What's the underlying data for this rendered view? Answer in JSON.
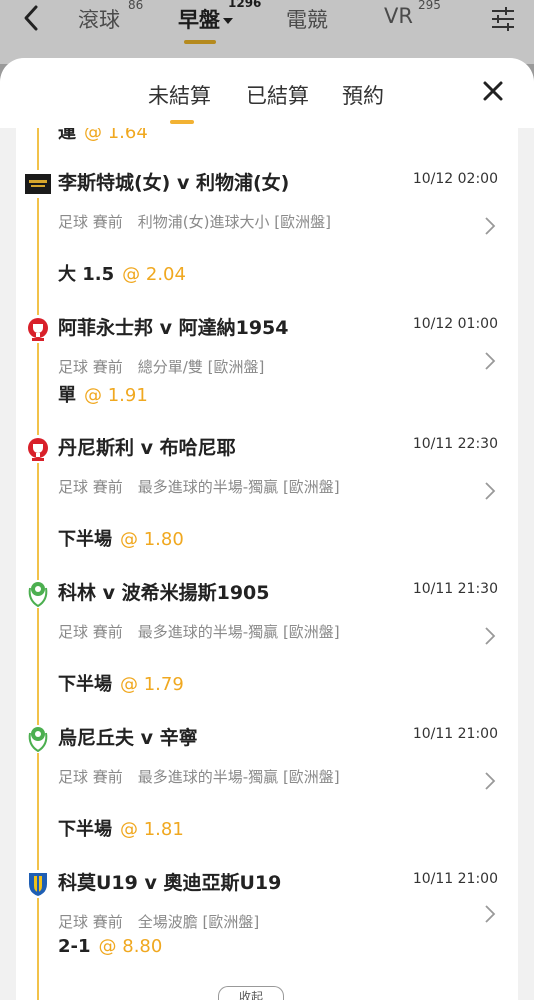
{
  "top_nav": {
    "tabs": [
      {
        "label": "滾球",
        "count": "86"
      },
      {
        "label": "早盤",
        "count": "1296"
      },
      {
        "label": "電競",
        "count": ""
      },
      {
        "label": "VR",
        "count": "295"
      }
    ],
    "active_tab": "早盤"
  },
  "sheet": {
    "tabs": [
      "未結算",
      "已結算",
      "預約"
    ],
    "active_tab": "未結算"
  },
  "partial_row": {
    "pick": "運",
    "odds": "@ 1.64"
  },
  "bets": [
    {
      "logo": "league-badge-dark",
      "teams": "李斯特城(女) v 利物浦(女)",
      "time": "10/12 02:00",
      "desc": "足球 賽前　利物浦(女)進球大小 [歐洲盤]",
      "pick": "大 1.5",
      "odds": "@ 2.04"
    },
    {
      "logo": "cup-trophy-red",
      "teams": "阿菲永士邦 v 阿達納1954",
      "time": "10/12 01:00",
      "desc": "足球 賽前　總分單/雙 [歐洲盤]",
      "pick": "單",
      "odds": "@ 1.91"
    },
    {
      "logo": "cup-trophy-red",
      "teams": "丹尼斯利 v 布哈尼耶",
      "time": "10/11 22:30",
      "desc": "足球 賽前　最多進球的半場-獨贏 [歐洲盤]",
      "pick": "下半場",
      "odds": "@ 1.80"
    },
    {
      "logo": "cup-trophy-green",
      "teams": "科林 v 波希米揚斯1905",
      "time": "10/11 21:30",
      "desc": "足球 賽前　最多進球的半場-獨贏 [歐洲盤]",
      "pick": "下半場",
      "odds": "@ 1.79"
    },
    {
      "logo": "cup-trophy-green",
      "teams": "烏尼丘夫 v 辛寧",
      "time": "10/11 21:00",
      "desc": "足球 賽前　最多進球的半場-獨贏 [歐洲盤]",
      "pick": "下半場",
      "odds": "@ 1.81"
    },
    {
      "logo": "shield-badge-blue-yellow",
      "teams": "科莫U19 v 奧迪亞斯U19",
      "time": "10/11 21:00",
      "desc": "足球 賽前　全場波膽 [歐洲盤]",
      "pick": "2-1",
      "odds": "@ 8.80"
    }
  ],
  "collapse_label": "收起",
  "colors": {
    "accent": "#f2b233",
    "odds": "#f0a820",
    "nav_underline": "#b58a1e"
  }
}
